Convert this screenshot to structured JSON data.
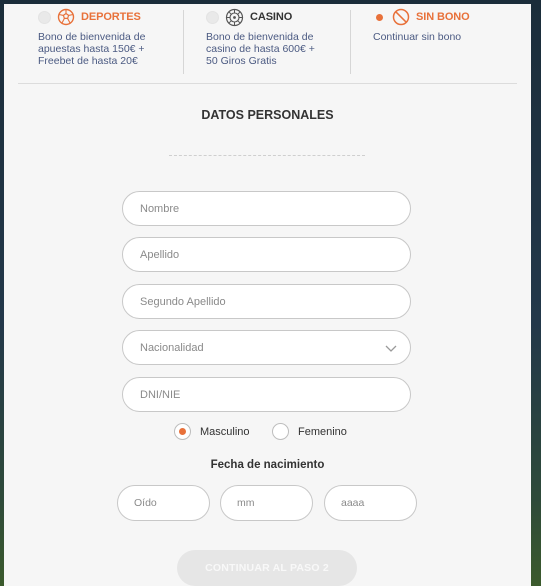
{
  "colors": {
    "accent": "#e8713a",
    "link_text": "#4b5a82",
    "background": "#f6f6f6"
  },
  "bonuses": [
    {
      "title": "DEPORTES",
      "title_color": "#e8713a",
      "icon": "soccer-ball-icon",
      "selected": false,
      "desc_lines": [
        "Bono de bienvenida de",
        "apuestas hasta 150€ +",
        "Freebet de hasta 20€"
      ]
    },
    {
      "title": "CASINO",
      "title_color": "#333333",
      "icon": "roulette-wheel-icon",
      "selected": false,
      "desc_lines": [
        "Bono de bienvenida de",
        "casino de hasta 600€ +",
        "50 Giros Gratis"
      ]
    },
    {
      "title": "SIN BONO",
      "title_color": "#e8713a",
      "icon": "no-bonus-icon",
      "selected": true,
      "desc_lines": [
        "Continuar sin bono"
      ]
    }
  ],
  "section_title": "DATOS PERSONALES",
  "fields": {
    "nombre": {
      "placeholder": "Nombre",
      "value": ""
    },
    "apellido": {
      "placeholder": "Apellido",
      "value": ""
    },
    "segundo_apellido": {
      "placeholder": "Segundo Apellido",
      "value": ""
    },
    "nacionalidad": {
      "placeholder": "Nacionalidad",
      "value": ""
    },
    "dni": {
      "placeholder": "DNI/NIE",
      "value": ""
    }
  },
  "gender": {
    "options": [
      {
        "label": "Masculino",
        "selected": true
      },
      {
        "label": "Femenino",
        "selected": false
      }
    ]
  },
  "dob": {
    "title": "Fecha de nacimiento",
    "day_placeholder": "Oído",
    "month_placeholder": "mm",
    "year_placeholder": "aaaa"
  },
  "cta_label": "CONTINUAR AL PASO 2"
}
